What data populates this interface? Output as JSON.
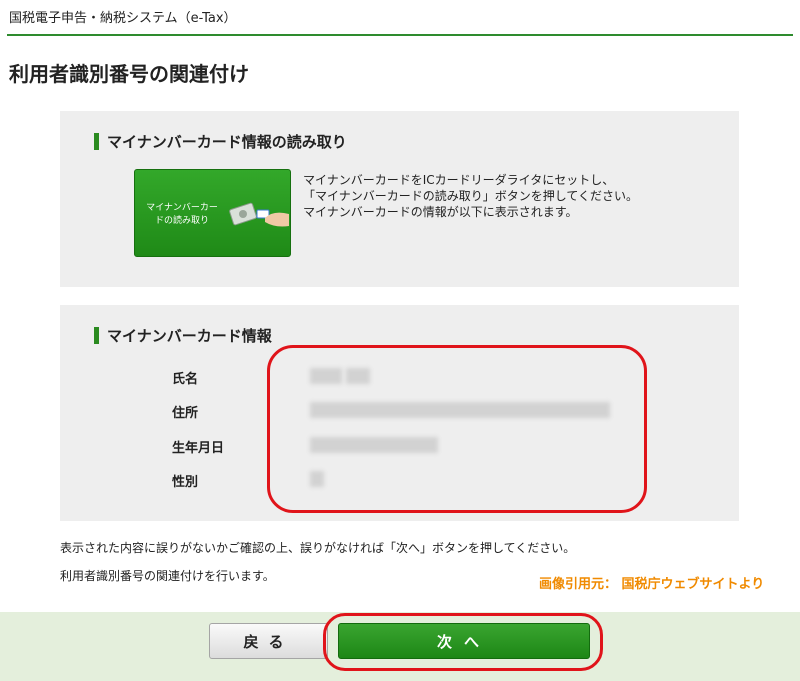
{
  "header": {
    "system_title": "国税電子申告・納税システム（e-Tax）"
  },
  "page": {
    "title": "利用者識別番号の関連付け"
  },
  "read_section": {
    "heading": "マイナンバーカード情報の読み取り",
    "button_label": "マイナンバーカードの読み取り",
    "instructions": [
      "マイナンバーカードをICカードリーダライタにセットし、",
      "「マイナンバーカードの読み取り」ボタンを押してください。",
      "マイナンバーカードの情報が以下に表示されます。"
    ]
  },
  "info_section": {
    "heading": "マイナンバーカード情報",
    "fields": [
      {
        "label": "氏名"
      },
      {
        "label": "住所"
      },
      {
        "label": "生年月日"
      },
      {
        "label": "性別"
      }
    ]
  },
  "notes": {
    "confirm": "表示された内容に誤りがないかご確認の上、誤りがなければ「次へ」ボタンを押してください。",
    "association": "利用者識別番号の関連付けを行います。"
  },
  "credit": "画像引用元： 国税庁ウェブサイトより",
  "footer": {
    "back_label": "戻る",
    "next_label": "次へ"
  },
  "colors": {
    "accent_green": "#2a8a1f",
    "highlight_red": "#e0141a",
    "credit_orange": "#f08a00",
    "footer_bg": "#e4efdc"
  },
  "icons": [
    "card-reader-icon",
    "hand-icon"
  ]
}
